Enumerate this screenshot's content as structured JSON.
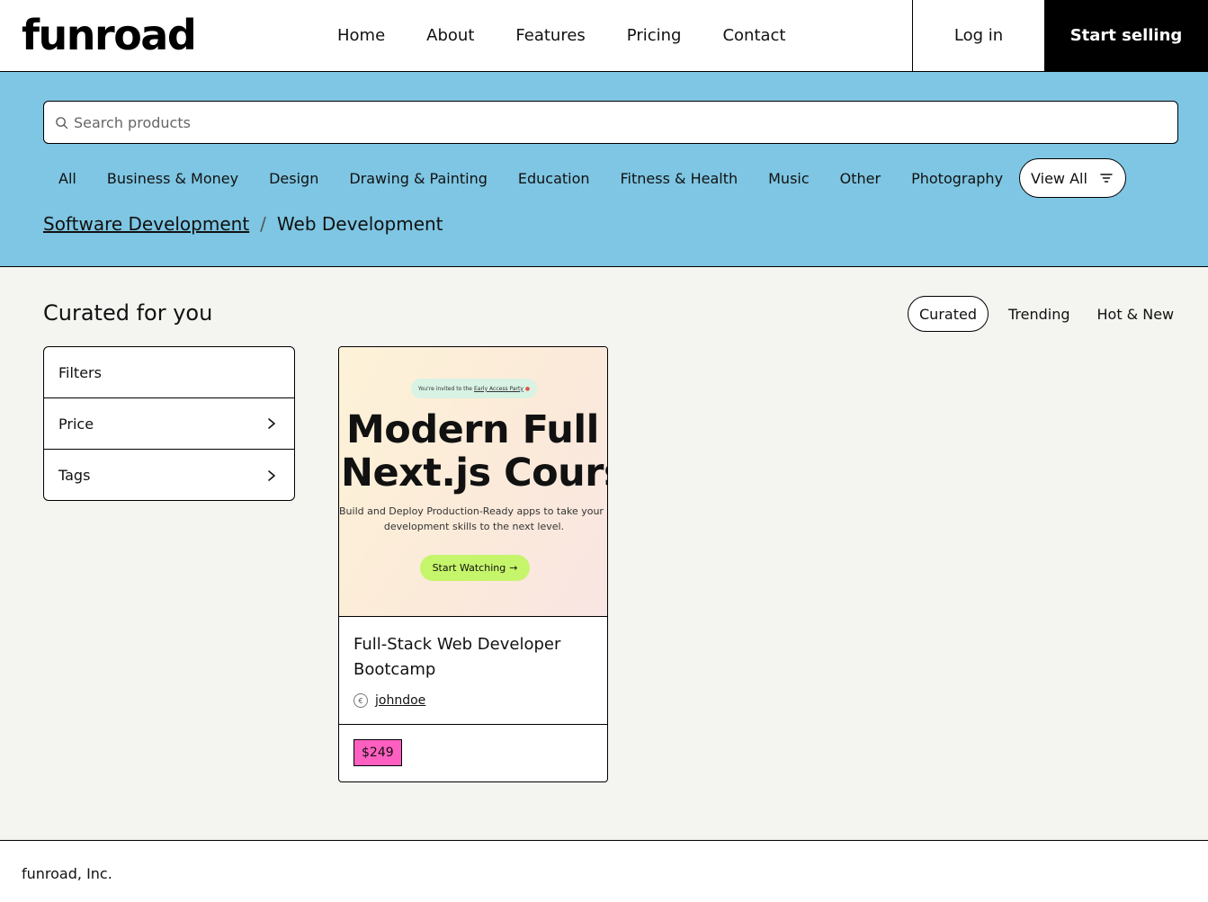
{
  "nav": {
    "logo": "funroad",
    "links": [
      "Home",
      "About",
      "Features",
      "Pricing",
      "Contact"
    ],
    "login": "Log in",
    "start_selling": "Start selling"
  },
  "search": {
    "placeholder": "Search products",
    "value": ""
  },
  "categories": {
    "items": [
      "All",
      "Business & Money",
      "Design",
      "Drawing & Painting",
      "Education",
      "Fitness & Health",
      "Music",
      "Other",
      "Photography"
    ],
    "view_all": "View All"
  },
  "breadcrumb": {
    "parent": "Software Development",
    "separator": "/",
    "current": "Web Development"
  },
  "main": {
    "title": "Curated for you",
    "tabs": [
      {
        "label": "Curated",
        "active": true
      },
      {
        "label": "Trending",
        "active": false
      },
      {
        "label": "Hot & New",
        "active": false
      }
    ]
  },
  "filters": {
    "header": "Filters",
    "items": [
      "Price",
      "Tags"
    ]
  },
  "products": [
    {
      "thumbnail": {
        "invite_text": "You're invited to the",
        "invite_link": "Early Access Party",
        "headline_line1": "Modern Full St",
        "headline_line2": "Next.js Course",
        "subtitle_line1": "Build and Deploy Production-Ready apps to take your web",
        "subtitle_line2": "development skills to the next level.",
        "cta": "Start Watching"
      },
      "name": "Full-Stack Web Developer Bootcamp",
      "author": "johndoe",
      "price": "$249",
      "price_color": "#ff5fc0"
    }
  ],
  "footer": {
    "text": "funroad, Inc."
  },
  "colors": {
    "band": "#7ec6e3",
    "background": "#f4f4f0",
    "accent_button": "#c5f56a"
  }
}
